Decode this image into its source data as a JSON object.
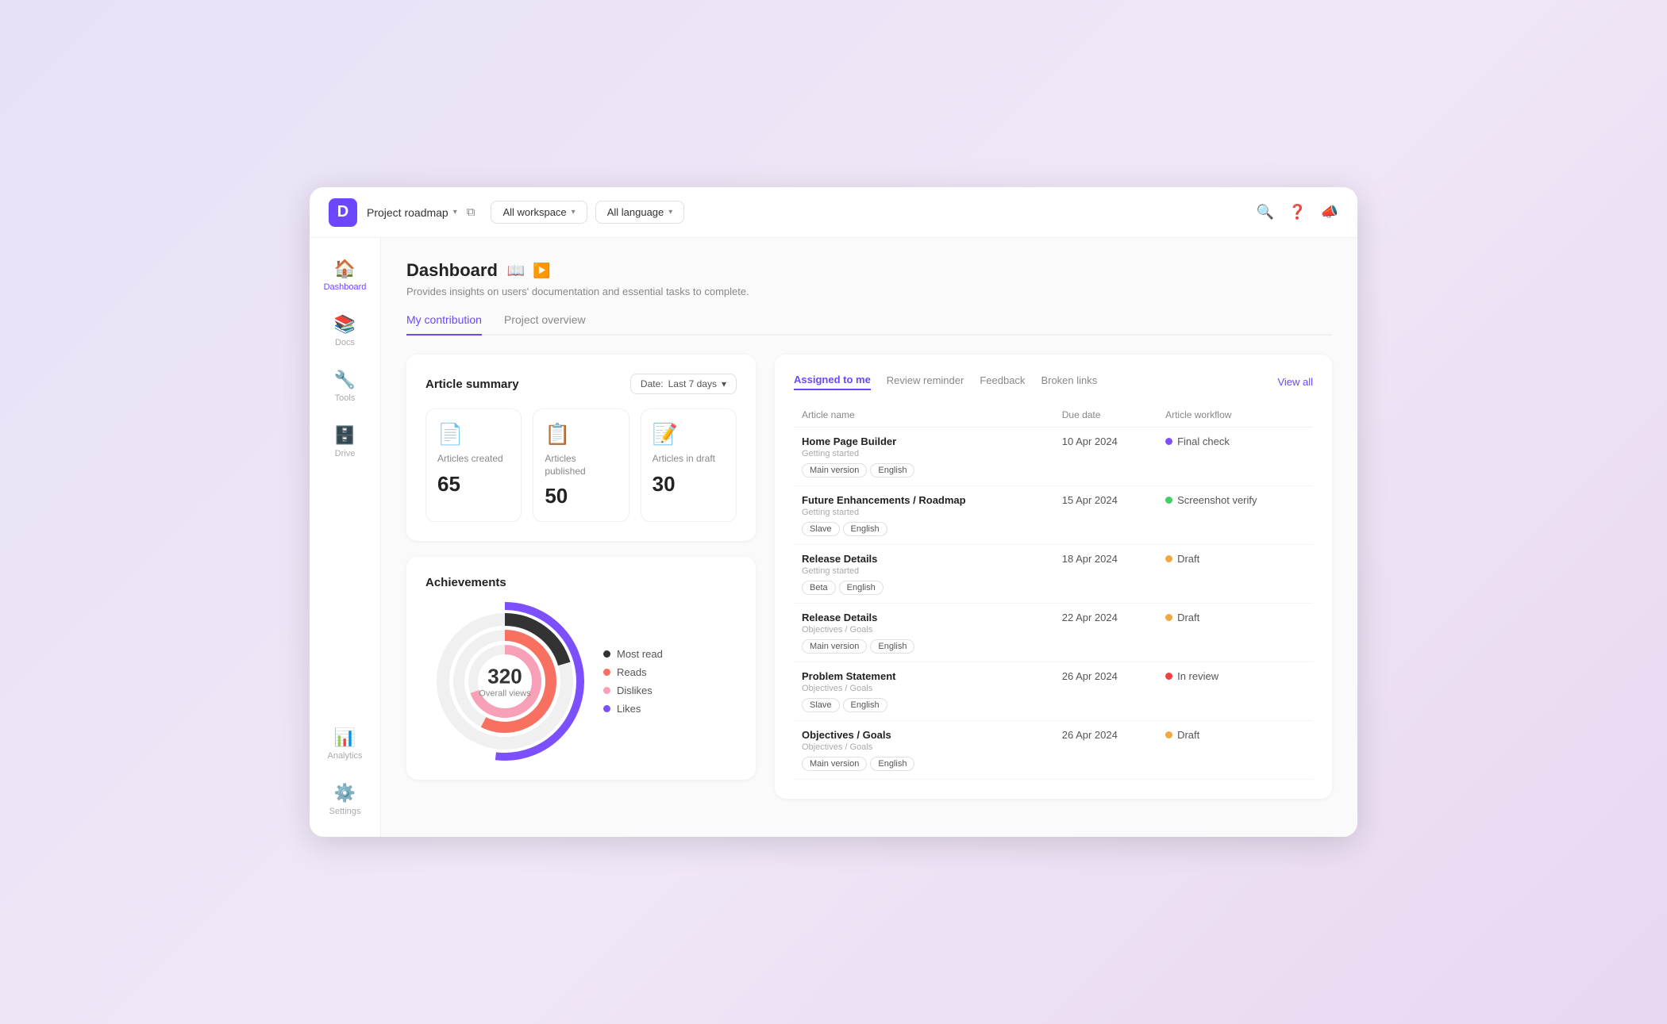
{
  "topbar": {
    "project_name": "Project roadmap",
    "workspace_filter": "All workspace",
    "language_filter": "All language"
  },
  "sidebar": {
    "items": [
      {
        "id": "dashboard",
        "label": "Dashboard",
        "icon": "🏠",
        "active": true
      },
      {
        "id": "docs",
        "label": "Docs",
        "icon": "📚",
        "active": false
      },
      {
        "id": "tools",
        "label": "Tools",
        "icon": "🔧",
        "active": false
      },
      {
        "id": "drive",
        "label": "Drive",
        "icon": "🗄️",
        "active": false
      },
      {
        "id": "analytics",
        "label": "Analytics",
        "icon": "📊",
        "active": false
      },
      {
        "id": "settings",
        "label": "Settings",
        "icon": "⚙️",
        "active": false
      }
    ]
  },
  "page": {
    "title": "Dashboard",
    "description": "Provides insights on users' documentation and essential tasks to complete.",
    "tabs": [
      {
        "label": "My contribution",
        "active": true
      },
      {
        "label": "Project overview",
        "active": false
      }
    ]
  },
  "article_summary": {
    "title": "Article summary",
    "date_label": "Date:",
    "date_value": "Last 7 days",
    "stats": [
      {
        "label": "Articles created",
        "value": "65",
        "icon_color": "#c8b8f0"
      },
      {
        "label": "Articles published",
        "value": "50",
        "icon_color": "#b8e8c8"
      },
      {
        "label": "Articles in draft",
        "value": "30",
        "icon_color": "#f8e0a0"
      }
    ]
  },
  "achievements": {
    "title": "Achievements",
    "chart": {
      "overall_views_value": "320",
      "overall_views_label": "Overall views"
    },
    "legend": [
      {
        "label": "Most read",
        "color": "#333333"
      },
      {
        "label": "Reads",
        "color": "#f87060"
      },
      {
        "label": "Dislikes",
        "color": "#f8a0b8"
      },
      {
        "label": "Likes",
        "color": "#7c50ff"
      }
    ]
  },
  "tasks": {
    "tabs": [
      {
        "label": "Assigned to me",
        "active": true
      },
      {
        "label": "Review reminder",
        "active": false
      },
      {
        "label": "Feedback",
        "active": false
      },
      {
        "label": "Broken links",
        "active": false
      }
    ],
    "view_all": "View all",
    "columns": [
      "Article name",
      "Due date",
      "Article workflow"
    ],
    "rows": [
      {
        "name": "Home Page Builder",
        "sub": "Getting started",
        "tags": [
          "Main version",
          "English"
        ],
        "due": "10 Apr 2024",
        "workflow": "Final check",
        "workflow_color": "#7c50ff"
      },
      {
        "name": "Future Enhancements / Roadmap",
        "sub": "Getting started",
        "tags": [
          "Slave",
          "English"
        ],
        "due": "15 Apr 2024",
        "workflow": "Screenshot verify",
        "workflow_color": "#44cc66"
      },
      {
        "name": "Release Details",
        "sub": "Getting started",
        "tags": [
          "Beta",
          "English"
        ],
        "due": "18 Apr 2024",
        "workflow": "Draft",
        "workflow_color": "#f0a840"
      },
      {
        "name": "Release Details",
        "sub": "Objectives / Goals",
        "tags": [
          "Main version",
          "English"
        ],
        "due": "22 Apr 2024",
        "workflow": "Draft",
        "workflow_color": "#f0a840"
      },
      {
        "name": "Problem Statement",
        "sub": "Objectives / Goals",
        "tags": [
          "Slave",
          "English"
        ],
        "due": "26 Apr 2024",
        "workflow": "In review",
        "workflow_color": "#f04040"
      },
      {
        "name": "Objectives / Goals",
        "sub": "Objectives / Goals",
        "tags": [
          "Main version",
          "English"
        ],
        "due": "26 Apr 2024",
        "workflow": "Draft",
        "workflow_color": "#f0a840"
      }
    ]
  }
}
